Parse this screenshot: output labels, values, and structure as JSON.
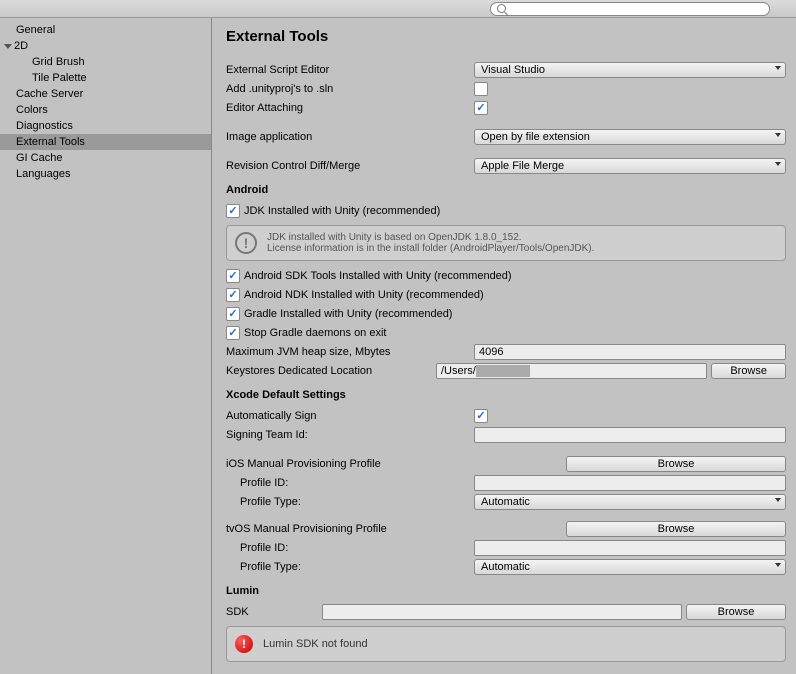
{
  "sidebar": {
    "items": [
      {
        "label": "General",
        "level": 0
      },
      {
        "label": "2D",
        "level": 0,
        "expanded": true
      },
      {
        "label": "Grid Brush",
        "level": 1
      },
      {
        "label": "Tile Palette",
        "level": 1
      },
      {
        "label": "Cache Server",
        "level": 0
      },
      {
        "label": "Colors",
        "level": 0
      },
      {
        "label": "Diagnostics",
        "level": 0
      },
      {
        "label": "External Tools",
        "level": 0,
        "selected": true
      },
      {
        "label": "GI Cache",
        "level": 0
      },
      {
        "label": "Languages",
        "level": 0
      }
    ]
  },
  "page": {
    "title": "External Tools"
  },
  "editor": {
    "external_script_editor_label": "External Script Editor",
    "external_script_editor_value": "Visual Studio",
    "add_unityproj_label": "Add .unityproj's to .sln",
    "editor_attaching_label": "Editor Attaching",
    "image_application_label": "Image application",
    "image_application_value": "Open by file extension",
    "revision_control_label": "Revision Control Diff/Merge",
    "revision_control_value": "Apple File Merge"
  },
  "android": {
    "heading": "Android",
    "jdk_label": "JDK Installed with Unity (recommended)",
    "info_line1": "JDK installed with Unity is based on OpenJDK 1.8.0_152.",
    "info_line2": "License information is in the install folder (AndroidPlayer/Tools/OpenJDK).",
    "sdk_tools_label": "Android SDK Tools Installed with Unity (recommended)",
    "ndk_label": "Android NDK Installed with Unity (recommended)",
    "gradle_label": "Gradle Installed with Unity (recommended)",
    "stop_gradle_label": "Stop Gradle daemons on exit",
    "max_heap_label": "Maximum JVM heap size, Mbytes",
    "max_heap_value": "4096",
    "keystore_label": "Keystores Dedicated Location",
    "keystore_value": "/Users/",
    "browse_label": "Browse"
  },
  "xcode": {
    "heading": "Xcode Default Settings",
    "auto_sign_label": "Automatically Sign",
    "signing_team_label": "Signing Team Id:",
    "ios_profile_heading": "iOS Manual Provisioning Profile",
    "tvos_profile_heading": "tvOS Manual Provisioning Profile",
    "profile_id_label": "Profile ID:",
    "profile_type_label": "Profile Type:",
    "profile_type_value": "Automatic",
    "browse_label": "Browse"
  },
  "lumin": {
    "heading": "Lumin",
    "sdk_label": "SDK",
    "browse_label": "Browse",
    "error_text": "Lumin SDK not found"
  }
}
